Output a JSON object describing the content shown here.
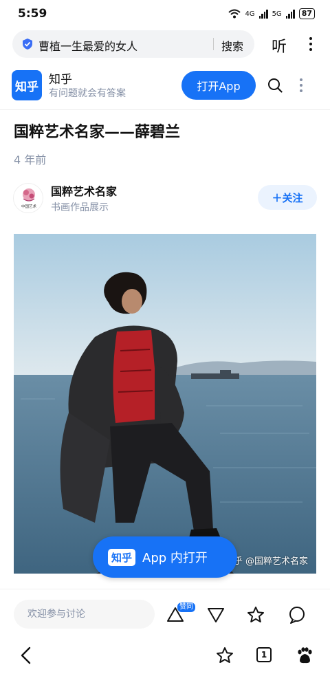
{
  "status_bar": {
    "time": "5:59",
    "net1": "4G",
    "net2": "5G",
    "battery": "87"
  },
  "browser": {
    "query": "曹植一生最爱的女人",
    "search_label": "搜索",
    "listen_label": "听",
    "more_icon": "more-vertical-icon"
  },
  "app_banner": {
    "logo": "知乎",
    "name": "知乎",
    "slogan": "有问题就会有答案",
    "open_button": "打开App"
  },
  "article": {
    "title": "国粹艺术名家——薛碧兰",
    "time": "4 年前",
    "author": {
      "name": "国粹艺术名家",
      "desc": "书画作品展示",
      "avatar_text": "中国艺术"
    },
    "follow_label": "＋关注",
    "photo_watermark": "知乎 @国粹艺术名家"
  },
  "floating_open": {
    "logo": "知乎",
    "label": "App 内打开"
  },
  "comment_bar": {
    "placeholder": "欢迎参与讨论",
    "vote_badge": "赞同"
  },
  "bottom_nav": {
    "tabs_count": "1"
  },
  "colors": {
    "brand_blue": "#1772f6",
    "muted_text": "#8590a6"
  }
}
